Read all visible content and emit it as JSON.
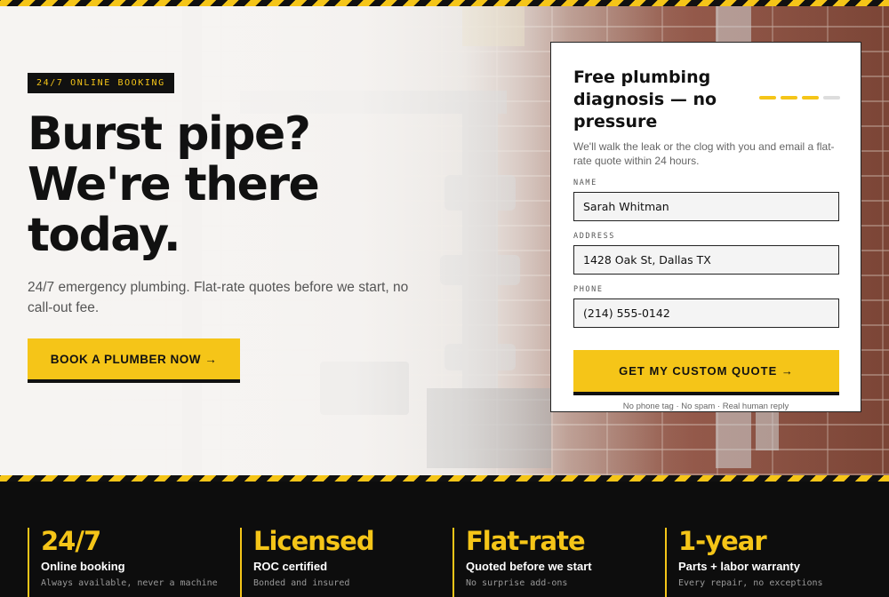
{
  "hero": {
    "badge": "24/7 ONLINE BOOKING",
    "headline_line1": "Burst pipe?",
    "headline_line2": "We're there",
    "headline_line3": "today.",
    "subtext": "24/7 emergency plumbing. Flat-rate quotes before we start, no call-out fee.",
    "cta_label": "BOOK A PLUMBER NOW →"
  },
  "form": {
    "title": "Free plumbing diagnosis — no pressure",
    "description": "We'll walk the leak or the clog with you and email a flat-rate quote within 24 hours.",
    "steps": {
      "total": 4,
      "completed": 3
    },
    "fields": [
      {
        "label": "NAME",
        "value": "Sarah Whitman"
      },
      {
        "label": "ADDRESS",
        "value": "1428 Oak St, Dallas TX"
      },
      {
        "label": "PHONE",
        "value": "(214) 555-0142"
      }
    ],
    "submit_label": "GET MY CUSTOM QUOTE →",
    "fine_print": "No phone tag · No spam · Real human reply"
  },
  "stats": [
    {
      "big": "24/7",
      "title": "Online booking",
      "sub": "Always available, never a machine"
    },
    {
      "big": "Licensed",
      "title": "ROC certified",
      "sub": "Bonded and insured"
    },
    {
      "big": "Flat-rate",
      "title": "Quoted before we start",
      "sub": "No surprise add-ons"
    },
    {
      "big": "1-year",
      "title": "Parts + labor warranty",
      "sub": "Every repair, no exceptions"
    }
  ],
  "colors": {
    "accent": "#f5c518",
    "dark": "#111111",
    "step_inactive": "#dddddd"
  }
}
